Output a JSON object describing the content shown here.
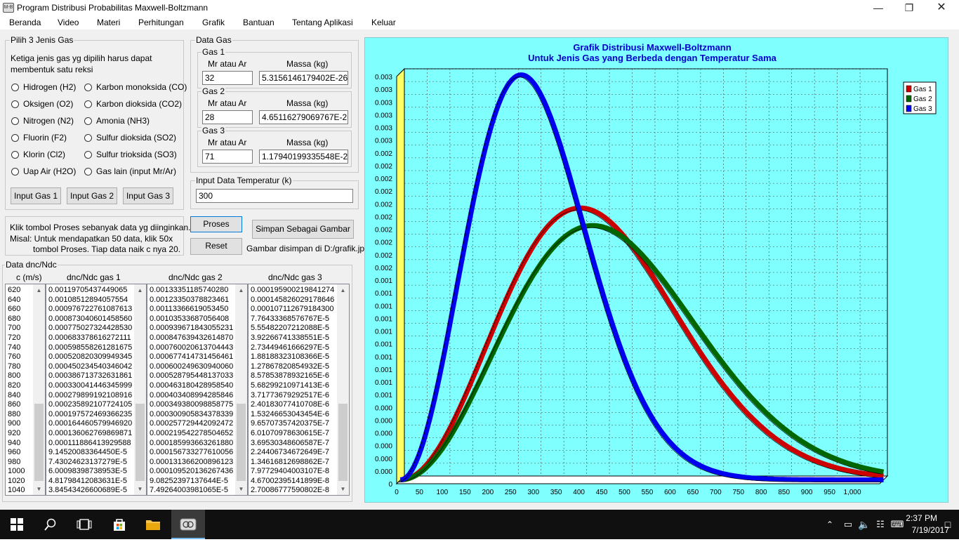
{
  "window": {
    "title": "Program Distribusi Probabilitas Maxwell-Boltzmann",
    "icon": "app-icon",
    "icon_text": "M-B"
  },
  "menu": [
    "Beranda",
    "Video",
    "Materi",
    "Perhitungan",
    "Grafik",
    "Bantuan",
    "Tentang Aplikasi",
    "Keluar"
  ],
  "gas_select": {
    "title": "Pilih 3 Jenis Gas",
    "desc1": "Ketiga jenis gas yg dipilih harus dapat",
    "desc2": "membentuk satu reksi",
    "left": [
      "Hidrogen (H2)",
      "Oksigen (O2)",
      "Nitrogen (N2)",
      "Fluorin (F2)",
      "Klorin (Cl2)",
      "Uap Air (H2O)"
    ],
    "right": [
      "Karbon monoksida (CO)",
      "Karbon dioksida (CO2)",
      "Amonia (NH3)",
      "Sulfur dioksida (SO2)",
      "Sulfur trioksida (SO3)",
      "Gas lain (input Mr/Ar)"
    ],
    "buttons": [
      "Input Gas 1",
      "Input Gas 2",
      "Input Gas 3"
    ]
  },
  "gas_data": {
    "title": "Data Gas",
    "col_mr": "Mr atau Ar",
    "col_mass": "Massa (kg)",
    "gases": [
      {
        "title": "Gas 1",
        "mr": "32",
        "mass": "5.3156146179402E-26"
      },
      {
        "title": "Gas 2",
        "mr": "28",
        "mass": "4.65116279069767E-26"
      },
      {
        "title": "Gas 3",
        "mr": "71",
        "mass": "1.17940199335548E-25"
      }
    ]
  },
  "temperature": {
    "title": "Input Data Temperatur (k)",
    "value": "300"
  },
  "info": {
    "line1": "Klik tombol Proses sebanyak data yg diinginkan.",
    "line2": "Misal: Untuk mendapatkan 50 data, klik 50x",
    "line3": "tombol Proses. Tiap data naik c nya 20."
  },
  "buttons": {
    "proses": "Proses",
    "reset": "Reset",
    "simpan": "Simpan Sebagai Gambar"
  },
  "save_note": "Gambar disimpan di D:/grafik.jpg",
  "data_table": {
    "title": "Data dnc/Ndc",
    "headers": [
      "c (m/s)",
      "dnc/Ndc gas 1",
      "dnc/Ndc gas 2",
      "dnc/Ndc gas 3"
    ],
    "c": [
      "620",
      "640",
      "660",
      "680",
      "700",
      "720",
      "740",
      "760",
      "780",
      "800",
      "820",
      "840",
      "860",
      "880",
      "900",
      "920",
      "940",
      "960",
      "980",
      "1000",
      "1020",
      "1040"
    ],
    "g1": [
      "0.00119705437449065",
      "0.00108512894057554",
      "0.000976722761087613",
      "0.000873040601458560",
      "0.000775027324428530",
      "0.000683378616272111",
      "0.000598558261281675",
      "0.000520820309949345",
      "0.000450234540346042",
      "0.000386713732631861",
      "0.000330041446345999",
      "0.000279899192108916",
      "0.000235892107724105",
      "0.000197572469366235",
      "0.000164460579946920",
      "0.000136062769869871",
      "0.000111886413929588",
      "9.14520083364450E-5",
      "7.43024623137279E-5",
      "6.00098398738953E-5",
      "4.81798412083631E-5",
      "3.84543426600689E-5"
    ],
    "g2": [
      "0.00133351185740280",
      "0.00123350378823461",
      "0.00113366619053450",
      "0.00103533687056408",
      "0.000939671843055231",
      "0.000847639432614870",
      "0.000760020613704443",
      "0.000677414731456461",
      "0.000600249630940060",
      "0.000528795448137033",
      "0.000463180428958540",
      "0.000403408994285846",
      "0.000349380098858775",
      "0.000300905834378339",
      "0.000257729442092472",
      "0.000219542278504652",
      "0.000185993663261880",
      "0.000156733277610056",
      "0.000131366200896123",
      "0.000109520136267436",
      "9.08252397137644E-5",
      "7.49264003981065E-5"
    ],
    "g3": [
      "0.000195900219841274",
      "0.000145826029178646",
      "0.000107112679184300",
      "7.76433368576767E-5",
      "5.55482207212088E-5",
      "3.92266741338551E-5",
      "2.73449461666297E-5",
      "1.88188323108366E-5",
      "1.27867820854932E-5",
      "8.57853878932165E-6",
      "5.68299210971413E-6",
      "3.71773679292517E-6",
      "2.40183077410708E-6",
      "1.53246653043454E-6",
      "9.65707357420375E-7",
      "6.01070978630615E-7",
      "3.69530348606587E-7",
      "2.24406734672649E-7",
      "1.34616812698862E-7",
      "7.97729404003107E-8",
      "4.67002395141899E-8",
      "2.70086777590802E-8"
    ]
  },
  "chart_data": {
    "type": "line",
    "title": "Grafik Distribusi Maxwell-Boltzmann",
    "subtitle": "Untuk Jenis Gas yang Berbeda dengan Temperatur Sama",
    "xlabel": "",
    "ylabel": "",
    "xlim": [
      0,
      1060
    ],
    "ylim": [
      0,
      0.00315
    ],
    "x_ticks": [
      "0",
      "50",
      "100",
      "150",
      "200",
      "250",
      "300",
      "350",
      "400",
      "450",
      "500",
      "550",
      "600",
      "650",
      "700",
      "750",
      "800",
      "850",
      "900",
      "950",
      "1,000"
    ],
    "y_ticks": [
      "0",
      "0.000",
      "0.000",
      "0.000",
      "0.000",
      "0.000",
      "0.000",
      "0.001",
      "0.001",
      "0.001",
      "0.001",
      "0.001",
      "0.001",
      "0.001",
      "0.001",
      "0.001",
      "0.001",
      "0.002",
      "0.002",
      "0.002",
      "0.002",
      "0.002",
      "0.002",
      "0.002",
      "0.002",
      "0.002",
      "0.002",
      "0.003",
      "0.003",
      "0.003",
      "0.003",
      "0.003",
      "0.003"
    ],
    "legend": "top-right",
    "grid": true,
    "series": [
      {
        "name": "Gas 1",
        "color": "#cc0000",
        "mass_kg": 5.3156146179402e-26
      },
      {
        "name": "Gas 2",
        "color": "#006600",
        "mass_kg": 4.65116279069767e-26
      },
      {
        "name": "Gas 3",
        "color": "#0000ee",
        "mass_kg": 1.17940199335548e-25
      }
    ],
    "temperature_k": 300,
    "background": "#80ffff",
    "title_color": "#0000cc"
  },
  "taskbar": {
    "time": "2:37 PM",
    "date": "7/19/2017"
  }
}
